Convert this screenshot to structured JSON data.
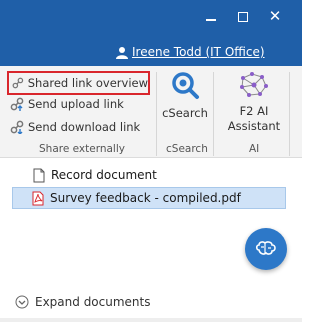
{
  "header": {
    "user_name": "Ireene Todd (IT Office)",
    "bg_color": "#1f5fa8"
  },
  "ribbon": {
    "share_group": {
      "items": [
        {
          "label": "Shared link overview",
          "icon": "link-icon",
          "highlighted": true
        },
        {
          "label": "Send upload link",
          "icon": "upload-link-icon"
        },
        {
          "label": "Send download link",
          "icon": "download-link-icon"
        }
      ],
      "group_label": "Share externally"
    },
    "csearch": {
      "label": "cSearch",
      "group_label": "cSearch",
      "icon": "search-icon"
    },
    "ai": {
      "label_line1": "F2 AI",
      "label_line2": "Assistant",
      "group_label": "AI",
      "icon": "ai-network-icon"
    }
  },
  "documents": [
    {
      "label": "Record document",
      "icon": "document-icon",
      "selected": false
    },
    {
      "label": "Survey feedback - compiled.pdf",
      "icon": "pdf-icon",
      "selected": true
    }
  ],
  "expand_label": "Expand documents",
  "fab": {
    "icon": "brain-icon"
  },
  "colors": {
    "highlight_border": "#d9262c",
    "selection": "#cfe2f7",
    "accent": "#2d78c8"
  }
}
